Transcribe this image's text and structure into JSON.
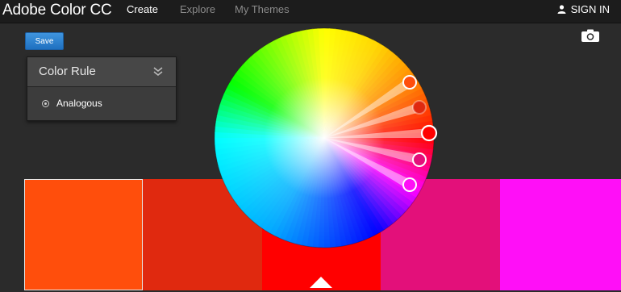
{
  "app": {
    "title": "Adobe Color CC"
  },
  "nav": {
    "create": "Create",
    "explore": "Explore",
    "my_themes": "My Themes",
    "sign_in": "SIGN IN"
  },
  "toolbar": {
    "save_label": "Save"
  },
  "color_rule": {
    "title": "Color Rule",
    "selected": "Analogous"
  },
  "icons": {
    "user": "user-icon",
    "camera": "camera-icon",
    "chevron": "double-chevron-down-icon",
    "pointer": "triangle-up-icon"
  },
  "swatches": [
    {
      "color": "#ff4e0c"
    },
    {
      "color": "#e0290f"
    },
    {
      "color": "#ff0000"
    },
    {
      "color": "#e3107a"
    },
    {
      "color": "#ff0ff7"
    }
  ],
  "wheel_handles": [
    {
      "color": "#ff4e0c"
    },
    {
      "color": "#e0290f"
    },
    {
      "color": "#ff0000"
    },
    {
      "color": "#e3107a"
    },
    {
      "color": "#ff0ff7"
    }
  ]
}
